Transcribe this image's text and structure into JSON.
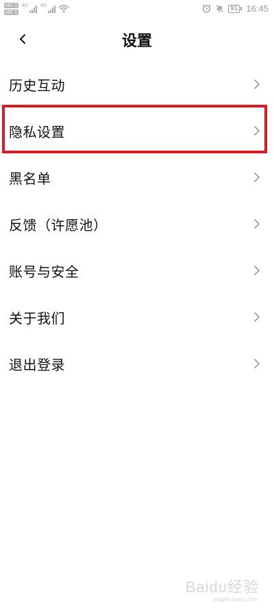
{
  "status_bar": {
    "hd_labels": [
      "HD 1",
      "HD 2"
    ],
    "network_1": "4G",
    "network_2": "4G",
    "wifi_icon": "wifi-icon",
    "alarm_icon": "alarm-icon",
    "mute_icon": "bell-off-icon",
    "battery": "91",
    "time": "16:45"
  },
  "header": {
    "back_icon": "chevron-left-icon",
    "title": "设置"
  },
  "menu": {
    "items": [
      {
        "label": "历史互动"
      },
      {
        "label": "隐私设置",
        "highlighted": true
      },
      {
        "label": "黑名单"
      },
      {
        "label": "反馈（许愿池）"
      },
      {
        "label": "账号与安全"
      },
      {
        "label": "关于我们"
      },
      {
        "label": "退出登录"
      }
    ]
  },
  "highlight_color": "#d71c24",
  "watermark": {
    "text": "Baidu经验",
    "sub": "jingyan.baidu.com"
  }
}
